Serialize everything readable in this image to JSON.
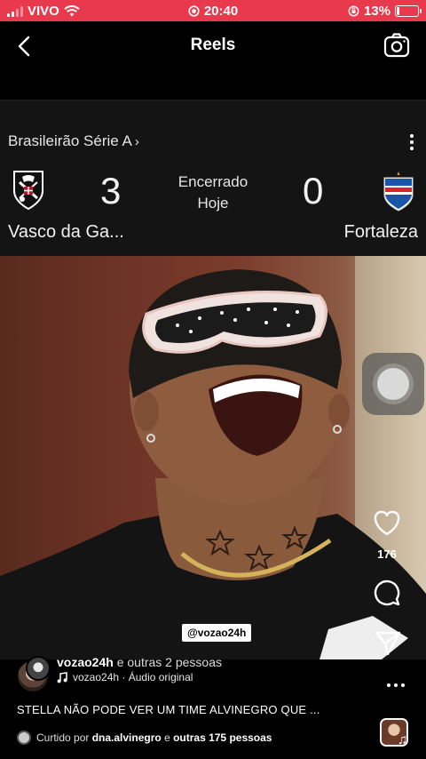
{
  "status_bar": {
    "carrier": "VIVO",
    "time": "20:40",
    "battery": "13%",
    "battery_level": 0.13,
    "signal_bars": 2
  },
  "header": {
    "title": "Reels",
    "back_icon": "chevron-left-icon",
    "camera_icon": "camera-icon"
  },
  "match": {
    "league": "Brasileirão Série A",
    "league_chevron": "›",
    "home_team": "Vasco da Ga...",
    "away_team": "Fortaleza",
    "home_score": "3",
    "away_score": "0",
    "status": "Encerrado",
    "day": "Hoje"
  },
  "video": {
    "watermark": "@vozao24h"
  },
  "actions": {
    "like_count": "176"
  },
  "post": {
    "author": "vozao24h",
    "author_suffix": " e outras 2 pessoas",
    "audio_author": "vozao24h",
    "audio_separator": " · ",
    "audio_label": "Áudio original",
    "caption": "STELLA NÃO PODE VER UM TIME ALVINEGRO QUE ...",
    "liked_prefix": "Curtido por ",
    "liked_user": "dna.alvinegro",
    "liked_middle": " e ",
    "liked_others": "outras 175 pessoas"
  },
  "colors": {
    "status_bar": "#e8394d",
    "card_bg": "#141414"
  }
}
